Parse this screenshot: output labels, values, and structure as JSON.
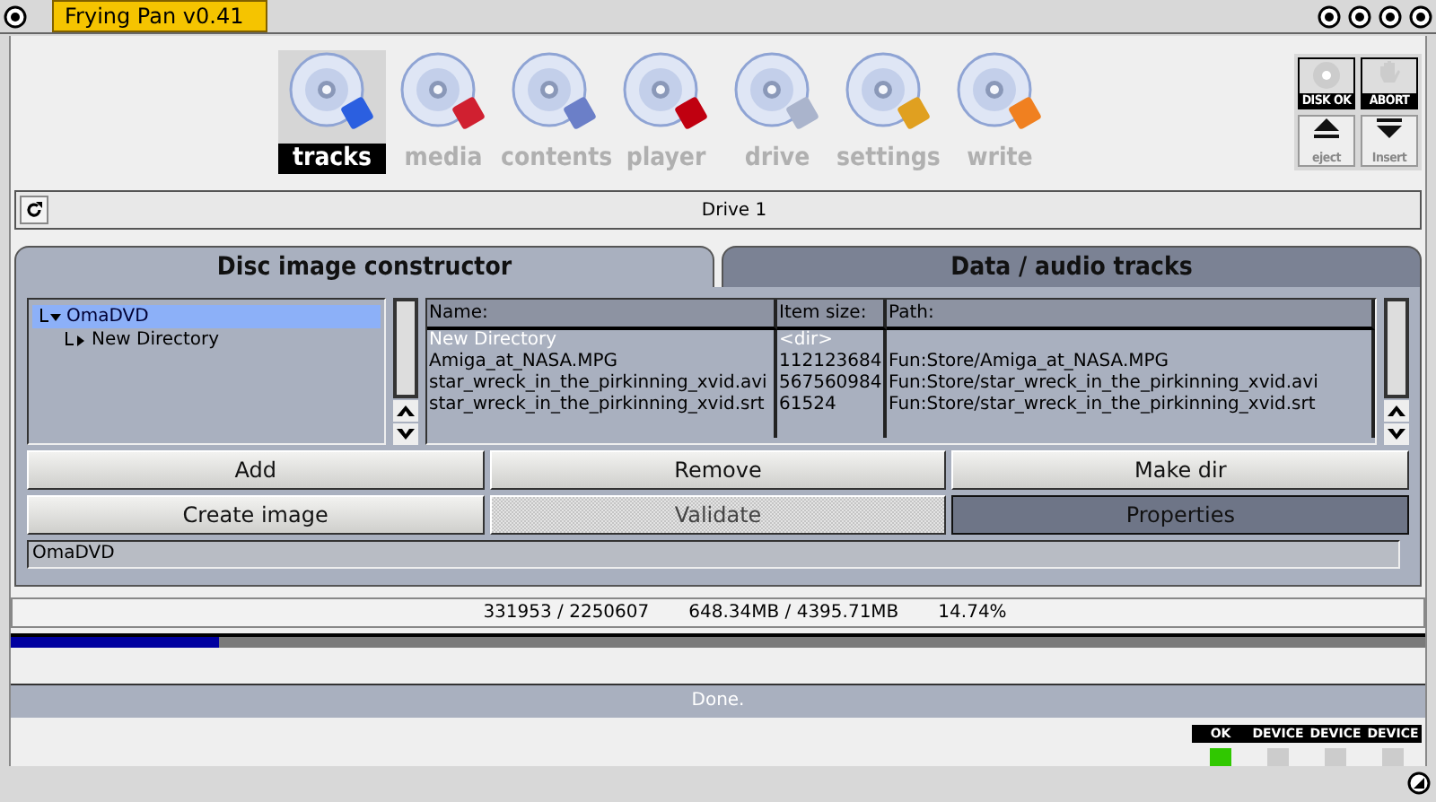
{
  "window": {
    "title": "Frying Pan v0.41"
  },
  "toolbar": {
    "items": [
      {
        "label": "tracks",
        "selected": true
      },
      {
        "label": "media",
        "selected": false
      },
      {
        "label": "contents",
        "selected": false
      },
      {
        "label": "player",
        "selected": false
      },
      {
        "label": "drive",
        "selected": false
      },
      {
        "label": "settings",
        "selected": false
      },
      {
        "label": "write",
        "selected": false
      }
    ]
  },
  "side_buttons": [
    {
      "label": "DISK OK",
      "kind": "disc"
    },
    {
      "label": "ABORT",
      "kind": "hand"
    },
    {
      "label": "eject",
      "kind": "eject"
    },
    {
      "label": "Insert",
      "kind": "insert"
    }
  ],
  "drive_bar": {
    "label": "Drive 1"
  },
  "tabs": [
    {
      "label": "Disc image constructor",
      "selected": true
    },
    {
      "label": "Data / audio tracks",
      "selected": false
    }
  ],
  "tree": [
    {
      "label": "OmaDVD",
      "expanded": true,
      "selected": true,
      "children": [
        {
          "label": "New Directory",
          "expanded": false,
          "selected": false
        }
      ]
    }
  ],
  "table": {
    "columns": [
      "Name:",
      "Item size:",
      "Path:"
    ],
    "rows": [
      {
        "cells": [
          "New Directory",
          "<dir>",
          ""
        ],
        "selected": true
      },
      {
        "cells": [
          "Amiga_at_NASA.MPG",
          "112123684",
          "Fun:Store/Amiga_at_NASA.MPG"
        ],
        "selected": false
      },
      {
        "cells": [
          "star_wreck_in_the_pirkinning_xvid.avi",
          "567560984",
          "Fun:Store/star_wreck_in_the_pirkinning_xvid.avi"
        ],
        "selected": false
      },
      {
        "cells": [
          "star_wreck_in_the_pirkinning_xvid.srt",
          "61524",
          "Fun:Store/star_wreck_in_the_pirkinning_xvid.srt"
        ],
        "selected": false
      }
    ]
  },
  "buttons": [
    {
      "label": "Add",
      "disabled": false,
      "pressed": false
    },
    {
      "label": "Remove",
      "disabled": false,
      "pressed": false
    },
    {
      "label": "Make dir",
      "disabled": false,
      "pressed": false
    },
    {
      "label": "Create image",
      "disabled": false,
      "pressed": false
    },
    {
      "label": "Validate",
      "disabled": true,
      "pressed": false
    },
    {
      "label": "Properties",
      "disabled": false,
      "pressed": true
    }
  ],
  "name_field": {
    "value": "OmaDVD"
  },
  "stats": [
    "331953 / 2250607",
    "648.34MB / 4395.71MB",
    "14.74%"
  ],
  "progress": {
    "level": 0.1474
  },
  "status": "Done.",
  "leds": [
    {
      "label": "OK",
      "on": true
    },
    {
      "label": "DEVICE",
      "on": false
    },
    {
      "label": "DEVICE",
      "on": false
    },
    {
      "label": "DEVICE",
      "on": false
    }
  ]
}
